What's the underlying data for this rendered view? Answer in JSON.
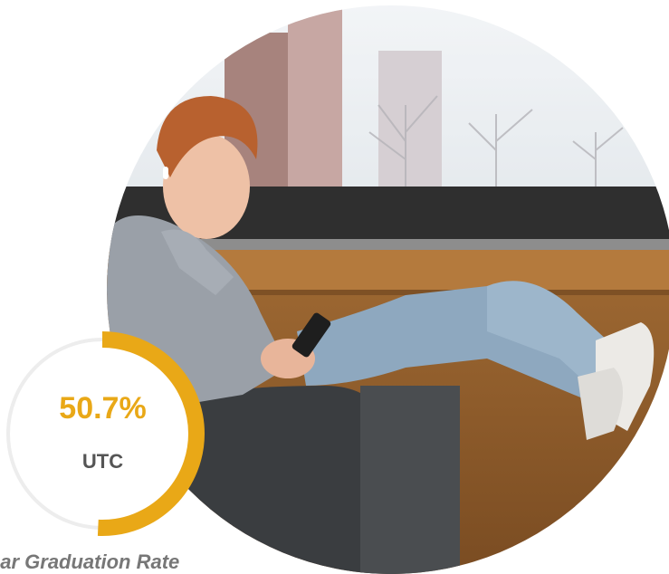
{
  "stat": {
    "value_text": "50.7%",
    "label": "UTC",
    "progress_fraction": 0.507,
    "accent_color": "#E9A817",
    "track_color": "#EDEDED"
  },
  "caption": "ear Graduation Rate",
  "photo": {
    "subject": "student-sitting-with-phone-by-window-icon"
  }
}
